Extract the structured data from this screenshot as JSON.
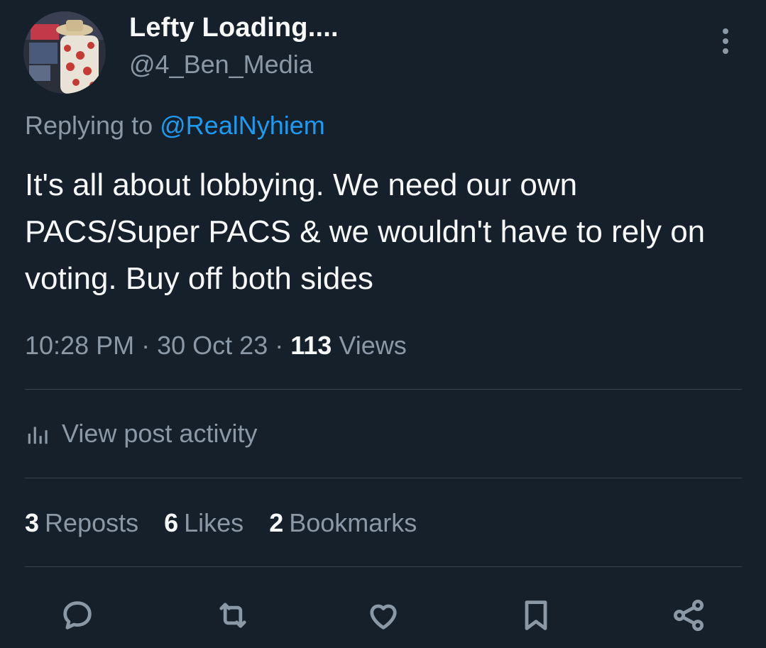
{
  "tweet": {
    "author_name": "Lefty Loading....",
    "author_handle": "@4_Ben_Media",
    "reply_prefix": "Replying to",
    "reply_to": "@RealNyhiem",
    "text": "It's all about lobbying. We need our own PACS/Super PACS & we wouldn't have to rely on voting. Buy off both sides",
    "time": "10:28 PM",
    "date": "30 Oct 23",
    "views_count": "113",
    "views_label": "Views",
    "separator": "·"
  },
  "activity": {
    "label": "View post activity"
  },
  "stats": [
    {
      "count": "3",
      "label": "Reposts"
    },
    {
      "count": "6",
      "label": "Likes"
    },
    {
      "count": "2",
      "label": "Bookmarks"
    }
  ],
  "actions": [
    {
      "icon": "reply-icon"
    },
    {
      "icon": "repost-icon"
    },
    {
      "icon": "like-icon"
    },
    {
      "icon": "bookmark-icon"
    },
    {
      "icon": "share-icon"
    }
  ],
  "colors": {
    "background": "#15202b",
    "primary_text": "#f7f9f9",
    "secondary_text": "#8b98a5",
    "link": "#1d9bf0",
    "divider": "#38444d"
  }
}
